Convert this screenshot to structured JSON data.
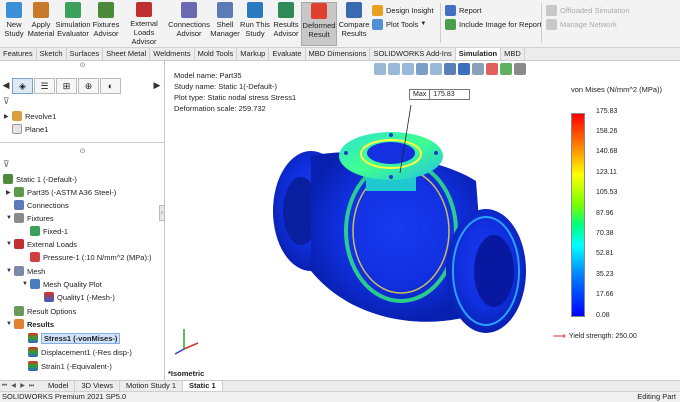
{
  "ribbon": {
    "buttons": [
      {
        "label": "New Study",
        "icon": "new-study-icon",
        "color": "#3a8fd6"
      },
      {
        "label": "Apply Material",
        "icon": "apply-material-icon",
        "color": "#c87a2a"
      },
      {
        "label": "Simulation Evaluator",
        "icon": "simulation-evaluator-icon",
        "color": "#3aa05a"
      },
      {
        "label": "Fixtures Advisor",
        "icon": "fixtures-advisor-icon",
        "color": "#4a8a3a"
      },
      {
        "label": "External Loads Advisor",
        "icon": "external-loads-advisor-icon",
        "color": "#c03030"
      },
      {
        "label": "Connections Advisor",
        "icon": "connections-advisor-icon",
        "color": "#6a6ab0"
      },
      {
        "label": "Shell Manager",
        "icon": "shell-manager-icon",
        "color": "#5a7ab8"
      },
      {
        "label": "Run This Study",
        "icon": "run-study-icon",
        "color": "#2a7ac0"
      },
      {
        "label": "Results Advisor",
        "icon": "results-advisor-icon",
        "color": "#2e8b57"
      },
      {
        "label": "Deformed Result",
        "icon": "deformed-result-icon",
        "color": "#e04030"
      },
      {
        "label": "Compare Results",
        "icon": "compare-results-icon",
        "color": "#3a6ab0"
      }
    ],
    "small": [
      {
        "label": "Design Insight",
        "icon": "design-insight-icon",
        "color": "#e8a020"
      },
      {
        "label": "Plot Tools",
        "icon": "plot-tools-icon",
        "color": "#5090d0"
      },
      {
        "label": "Report",
        "icon": "report-icon",
        "color": "#4070c0"
      },
      {
        "label": "Include Image for Report",
        "icon": "include-image-icon",
        "color": "#4aa04a"
      },
      {
        "label": "Offloaded Simulation",
        "icon": "offloaded-simulation-icon",
        "color": "#b0b0b0"
      },
      {
        "label": "Manage Network",
        "icon": "manage-network-icon",
        "color": "#b0b0b0"
      }
    ]
  },
  "tabs": [
    "Features",
    "Sketch",
    "Surfaces",
    "Sheet Metal",
    "Weldments",
    "Mold Tools",
    "Markup",
    "Evaluate",
    "MBD Dimensions",
    "SOLIDWORKS Add-Ins",
    "Simulation",
    "MBD"
  ],
  "active_tab": "Simulation",
  "tree_top": [
    {
      "label": "Revolve1",
      "icon": "revolve-icon"
    },
    {
      "label": "Plane1",
      "icon": "plane-icon"
    }
  ],
  "tree": [
    {
      "label": "Static 1 (-Default-)",
      "icon": "static-study-icon"
    },
    {
      "label": "Part35 (-ASTM A36 Steel-)",
      "icon": "part-icon"
    },
    {
      "label": "Connections",
      "icon": "connections-icon"
    },
    {
      "label": "Fixtures",
      "icon": "fixtures-icon"
    },
    {
      "label": "Fixed-1",
      "icon": "fixed-icon"
    },
    {
      "label": "External Loads",
      "icon": "external-loads-icon"
    },
    {
      "label": "Pressure-1 (:10 N/mm^2 (MPa):)",
      "icon": "pressure-icon"
    },
    {
      "label": "Mesh",
      "icon": "mesh-icon"
    },
    {
      "label": "Mesh Quality Plot",
      "icon": "mesh-quality-plot-icon"
    },
    {
      "label": "Quality1 (-Mesh-)",
      "icon": "quality-icon"
    },
    {
      "label": "Result Options",
      "icon": "result-options-icon"
    },
    {
      "label": "Results",
      "icon": "results-icon"
    },
    {
      "label": "Stress1 (-vonMises-)",
      "icon": "stress-icon"
    },
    {
      "label": "Displacement1 (-Res disp-)",
      "icon": "displacement-icon"
    },
    {
      "label": "Strain1 (-Equivalent-)",
      "icon": "strain-icon"
    }
  ],
  "view": {
    "model_name": "Model name: Part35",
    "study_name": "Study name: Static 1(-Default-)",
    "plot_type": "Plot type: Static nodal stress Stress1",
    "deformation": "Deformation scale: 259.732",
    "max_label": "Max",
    "max_value": "175.83",
    "view_orientation": "*Isometric"
  },
  "legend": {
    "title": "von Mises (N/mm^2 (MPa))",
    "values": [
      "175.83",
      "158.26",
      "140.68",
      "123.11",
      "105.53",
      "87.96",
      "70.38",
      "52.81",
      "35.23",
      "17.66",
      "0.08"
    ],
    "yield": "Yield strength: 250.00",
    "color_max": "#ff0000",
    "color_min": "#0000ff"
  },
  "bottom_tabs": [
    "Model",
    "3D Views",
    "Motion Study 1",
    "Static 1"
  ],
  "status": {
    "left": "SOLIDWORKS Premium 2021 SP5.0",
    "right": "Editing Part"
  }
}
